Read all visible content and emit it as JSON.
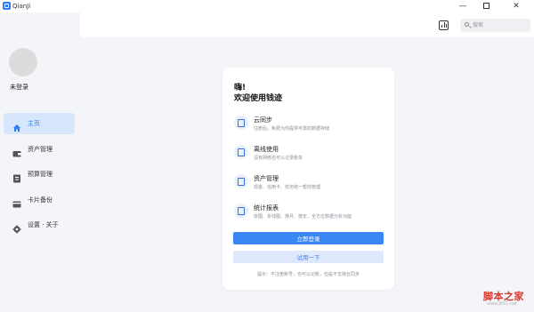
{
  "window": {
    "title": "QianJi",
    "minimize": "—",
    "close": "✕"
  },
  "sidebar": {
    "login_status": "未登录",
    "items": [
      {
        "label": "主页",
        "icon": "home-icon"
      },
      {
        "label": "资产管理",
        "icon": "wallet-icon"
      },
      {
        "label": "预算管理",
        "icon": "budget-icon"
      },
      {
        "label": "卡片备份",
        "icon": "card-icon"
      },
      {
        "label": "设置 · 关于",
        "icon": "gear-icon"
      }
    ]
  },
  "toolbar": {
    "stats_icon": "bar-chart-icon",
    "search_placeholder": "搜索"
  },
  "card": {
    "hello": "嗨!",
    "welcome": "欢迎使用钱迹",
    "features": [
      {
        "title": "云同步",
        "desc": "注册后，免费为你提供可靠的数据存储",
        "icon": "cloud-sync-icon"
      },
      {
        "title": "离线使用",
        "desc": "没有网络也可以记录账单",
        "icon": "offline-icon"
      },
      {
        "title": "资产管理",
        "desc": "现金、信用卡、债务统一帮你管理",
        "icon": "asset-icon"
      },
      {
        "title": "统计报表",
        "desc": "饼图、折线图、排月、按年、全方位数据分析功能",
        "icon": "report-icon"
      }
    ],
    "login_button": "立即登录",
    "try_button": "试用一下",
    "tip": "提示：不注册账号，也可以记账，但是不支持云同步"
  },
  "watermark": {
    "text": "脚本之家",
    "url": "www.jb51.net"
  },
  "colors": {
    "accent": "#3b86f5",
    "active_nav_bg": "#d6e6fb",
    "page_bg": "#f3f5f9"
  }
}
